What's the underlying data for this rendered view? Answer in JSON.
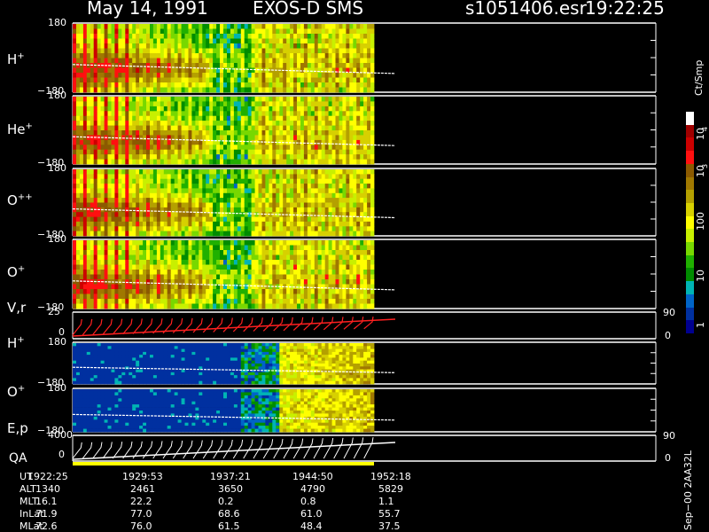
{
  "header": {
    "date_label": "May 14, 1991",
    "instrument_label": "EXOS-D SMS",
    "file_label": "s1051406.esr",
    "time_label": "19:22:25"
  },
  "panels": [
    {
      "id": "h-plus",
      "label": "H",
      "sup": "+",
      "ytop": "180",
      "ybot": "−180"
    },
    {
      "id": "he-plus",
      "label": "He",
      "sup": "+",
      "ytop": "180",
      "ybot": "−180"
    },
    {
      "id": "o-plusplus",
      "label": "O",
      "sup": "++",
      "ytop": "180",
      "ybot": "−180"
    },
    {
      "id": "o-plus",
      "label": "O",
      "sup": "+",
      "ytop": "180",
      "ybot": "−180"
    },
    {
      "id": "v-r",
      "label": "V,r",
      "sup": "",
      "ytop": "25",
      "ybot": "0",
      "right_top": "90",
      "right_bot": "0"
    },
    {
      "id": "h-plus-2",
      "label": "H",
      "sup": "+",
      "ytop": "180",
      "ybot": "−180"
    },
    {
      "id": "o-plus-2",
      "label": "O",
      "sup": "+",
      "ytop": "180",
      "ybot": "−180"
    },
    {
      "id": "e-p",
      "label": "E,p",
      "sup": "",
      "ytop": "4000",
      "ybot": "0",
      "right_top": "90",
      "right_bot": "0"
    }
  ],
  "qa_label": "QA",
  "colorbar": {
    "units_label": "Ct/Smp",
    "tick_labels": [
      "10",
      "4",
      "10",
      "3",
      "100",
      "10",
      "1"
    ],
    "colors": [
      "#ffffff",
      "#a00000",
      "#cc0000",
      "#ff1010",
      "#8b5a00",
      "#a07800",
      "#b4a000",
      "#d7d000",
      "#ffff00",
      "#c8f000",
      "#78d800",
      "#20b000",
      "#008c00",
      "#00b4b4",
      "#0064c8",
      "#0030a0",
      "#000090"
    ]
  },
  "footer": {
    "rows": [
      {
        "name": "UT",
        "values": [
          "1922:25",
          "1929:53",
          "1937:21",
          "1944:50",
          "1952:18"
        ]
      },
      {
        "name": "ALT",
        "values": [
          "1340",
          "2461",
          "3650",
          "4790",
          "5829"
        ]
      },
      {
        "name": "MLT",
        "values": [
          "16.1",
          "22.2",
          "0.2",
          "0.8",
          "1.1"
        ]
      },
      {
        "name": "InLat",
        "values": [
          "71.9",
          "77.0",
          "68.6",
          "61.0",
          "55.7"
        ]
      },
      {
        "name": "MLat",
        "values": [
          "72.6",
          "76.0",
          "61.5",
          "48.4",
          "37.5"
        ]
      }
    ],
    "version_label": "Sep−00  2AA32L"
  },
  "palette": {
    "background": "#000000",
    "axis": "#ffffff",
    "trace": "#ffffff",
    "velocity_trace": "#ff2020",
    "qa_bar": "#ffff00"
  },
  "chart_data": {
    "type": "heatmap",
    "x_ticks": [
      "1922:25",
      "1929:53",
      "1937:21",
      "1944:50",
      "1952:18"
    ],
    "colorbar_range": [
      1,
      10000
    ],
    "colorbar_scale": "log",
    "series": [
      {
        "name": "H+",
        "ylim": [
          -180,
          180
        ]
      },
      {
        "name": "He+",
        "ylim": [
          -180,
          180
        ]
      },
      {
        "name": "O++",
        "ylim": [
          -180,
          180
        ]
      },
      {
        "name": "O+",
        "ylim": [
          -180,
          180
        ]
      },
      {
        "name": "V,r",
        "ylim": [
          0,
          25
        ],
        "right_ylim": [
          0,
          90
        ]
      },
      {
        "name": "H+",
        "ylim": [
          -180,
          180
        ]
      },
      {
        "name": "O+",
        "ylim": [
          -180,
          180
        ]
      },
      {
        "name": "E,p",
        "ylim": [
          0,
          4000
        ],
        "right_ylim": [
          0,
          90
        ]
      }
    ]
  }
}
